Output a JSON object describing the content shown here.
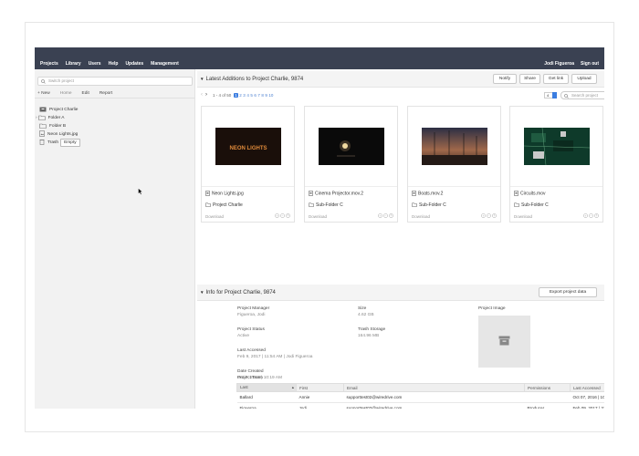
{
  "topbar": {
    "nav": [
      "Projects",
      "Library",
      "Users",
      "Help",
      "Updates",
      "Management"
    ],
    "user": "Jodi Figueroa",
    "signout": "Sign out"
  },
  "sidebar": {
    "switch_placeholder": "Switch project",
    "tabs": [
      "+ New",
      "Home",
      "Edit",
      "Report"
    ],
    "tree": {
      "project": "Project Charlie",
      "items": [
        "Folder A",
        "Folder B",
        "Neon Lights.jpg",
        "Trash"
      ],
      "empty_label": "Empty"
    }
  },
  "latest": {
    "title": "Latest Additions to Project Charlie, 9874",
    "buttons": [
      "Notify",
      "Share",
      "Get link",
      "Upload"
    ],
    "pager": {
      "range": "1 - 4 of 50",
      "pages": [
        "1",
        "2",
        "3",
        "4",
        "5",
        "6",
        "7",
        "8",
        "9",
        "10"
      ],
      "active_page": "1",
      "per_page": "4"
    },
    "search_placeholder": "Search project",
    "cards": [
      {
        "file": "Neon Lights.jpg",
        "folder": "Project Charlie",
        "download": "Download"
      },
      {
        "file": "Cinema Projector.mov.2",
        "folder": "Sub-Folder C",
        "download": "Download"
      },
      {
        "file": "Boats.mov.2",
        "folder": "Sub-Folder C",
        "download": "Download"
      },
      {
        "file": "Circuits.mov",
        "folder": "Sub-Folder C",
        "download": "Download"
      }
    ],
    "thumb_text": "NEON LIGHTS"
  },
  "info": {
    "title": "Info for Project Charlie, 9874",
    "export_label": "Export project data",
    "fields": {
      "manager_label": "Project Manager",
      "manager": "Figueroa, Jodi",
      "status_label": "Project Status",
      "status": "Active",
      "accessed_label": "Last Accessed",
      "accessed": "Feb 9, 2017 | 11:54 AM | Jodi Figueroa",
      "created_label": "Date Created",
      "created": "Oct 7, 2016 | 10:19 AM",
      "size_label": "Size",
      "size": "4.62 GB",
      "trash_label": "Trash Storage",
      "trash": "164.96 MB",
      "image_label": "Project Image"
    },
    "team_label": "Project Team",
    "team_columns": [
      "Last",
      "First",
      "Email",
      "Permissions",
      "Last Accessed"
    ],
    "team": [
      {
        "last": "Ballard",
        "first": "Annie",
        "email": "supporttest02@wiredrive.com",
        "perm": "",
        "accessed": "Oct 07, 2016 | 10:30 AM"
      },
      {
        "last": "Figueroa",
        "first": "Jodi",
        "email": "supporttest03@wiredrive.com",
        "perm": "Producer",
        "accessed": "Feb 09, 2017 | 3:46 PM"
      },
      {
        "last": "Hampton",
        "first": "Karen",
        "email": "supporttest01@wiredrive.com",
        "perm": "Review",
        "accessed": "Nov 11, 2016 | 11:50 AM"
      },
      {
        "last": "Hunt",
        "first": "Lonnie",
        "email": "supporttest03+basic@wiredrive.com",
        "perm": "Basic",
        "accessed": "Jan 27, 2017 | 8:22 AM"
      }
    ]
  }
}
